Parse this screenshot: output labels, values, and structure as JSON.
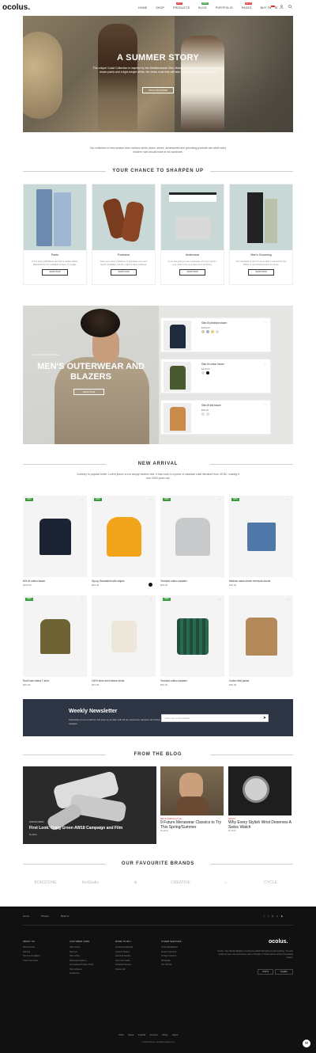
{
  "header": {
    "logo": "ocolus.",
    "nav": [
      {
        "label": "HOME",
        "badge": ""
      },
      {
        "label": "SHOP",
        "badge": ""
      },
      {
        "label": "PRODUCTS",
        "badge": "HOT",
        "badge_color": "#d33"
      },
      {
        "label": "BLOG",
        "badge": "NEW",
        "badge_color": "#3a9b3a"
      },
      {
        "label": "PORTFOLIO",
        "badge": ""
      },
      {
        "label": "PAGES",
        "badge": "SALE",
        "badge_color": "#d33"
      },
      {
        "label": "BUY THEME",
        "badge": ""
      }
    ]
  },
  "hero": {
    "title": "A SUMMER STORY",
    "text": "The unique Coast Collection is inspired by the Mediterranean Sea. Makes it ideal for a four-season look, of brown pants and a light-weight shirts, the dress code that will take you down wherever you want",
    "button": "DISCOVER MORE"
  },
  "intro": "Our collection of new season tees, buttons shirts, jeans, shoes, accessories and grooming products are what every modern man should have in his wardrobe.",
  "section_sharpen": "YOUR CHANCE TO SHARPEN UP",
  "categories": [
    {
      "name": "Pants",
      "desc": "It is a long established fact that a reader will be distracted by the readable content of a page.",
      "button": "SHOP NOW"
    },
    {
      "name": "Footwear",
      "desc": "There are many variations of passages of Lorem Ipsum available, but the majority have suffered.",
      "button": "SHOP NOW"
    },
    {
      "name": "Underwear",
      "desc": "If you are going to use a passage of Lorem Ipsum, you need to be sure there isn't anything.",
      "button": "SHOP NOW"
    },
    {
      "name": "Men's Grooming",
      "desc": "The standard chunk of Lorem Ipsum used since the 1500s is reproduced below for those.",
      "button": "SHOP NOW"
    }
  ],
  "men": {
    "small": "COLLECTION 2020 SALE",
    "title": "MEN'S OUTERWEAR AND BLAZERS",
    "button": "SHOP NOW",
    "products": [
      {
        "name": "Slim-fit pinstripe blazer",
        "price": "$159.00",
        "color": "#1e2a3d"
      },
      {
        "name": "Slim-fit cotton blazer",
        "price": "$129.00",
        "color": "#4a5a30"
      },
      {
        "name": "Slim-fit silk blazer",
        "price": "$99.00",
        "color": "#c98a4a"
      }
    ]
  },
  "section_arrival": "NEW ARRIVAL",
  "arrival_text": "Contrary to popular belief, Lorem Ipsum is not simply random text. It has roots in a piece of classical Latin literature from 45 BC, making it over 2000 years old.",
  "products": [
    {
      "name": "80's fit cotton blazer",
      "price": "$129.00",
      "badge": "NEW"
    },
    {
      "name": "Zip-up Sweatshirt with stripes",
      "price": "$69.00",
      "badge": "NEW"
    },
    {
      "name": "Textured cotton sweater",
      "price": "$59.00",
      "badge": "NEW"
    },
    {
      "name": "Medium wash denim bermuda shorts",
      "price": "$49.00",
      "badge": "NEW"
    },
    {
      "name": "Rust linen-blend T-shirt",
      "price": "$39.00",
      "badge": "NEW"
    },
    {
      "name": "100% linen shirt sleeve shirts",
      "price": "$49.00",
      "badge": ""
    },
    {
      "name": "Textured cotton sweater",
      "price": "$59.00",
      "badge": "NEW"
    },
    {
      "name": "Cotton field jacket",
      "price": "$99.00",
      "badge": ""
    }
  ],
  "newsletter": {
    "title": "Weekly Newsletter",
    "text": "Subscribe to our email list and stay up-to-date with all our awesome releases and latest updates.",
    "placeholder": "Enter your email address"
  },
  "section_blog": "FROM THE BLOG",
  "blog": [
    {
      "tag": "FASHION NEWS",
      "title": "First Look: Craig Green AW18 Campaign and Film",
      "by": "By admin"
    },
    {
      "tag": "MEN'S FASHION STYLE",
      "title": "9 Future Menswear Classics to Try This Spring/Summer",
      "by": "By admin"
    },
    {
      "tag": "WATCH",
      "title": "Why Every Stylish Wrist Deserves A Swiss Watch",
      "by": "By admin"
    }
  ],
  "section_brands": "OUR FAVOURITE BRANDS",
  "brands": [
    "BONSTONE",
    "thoStudio",
    "⊕",
    "CREATIVE",
    "⌂",
    "CYCLE"
  ],
  "footer": {
    "top_links": [
      "Home",
      "Privacy",
      "Returns"
    ],
    "columns": [
      {
        "title": "ABOUT US",
        "links": [
          "About Ocolus",
          "Sitemap",
          "Terms & Conditions",
          "Track Your Order"
        ]
      },
      {
        "title": "CUSTOMER CARE",
        "links": [
          "Help Center",
          "Payment",
          "How to Buy",
          "Shipping & Delivery",
          "International Product Policy",
          "How to Return",
          "Contact Us"
        ]
      },
      {
        "title": "MORE TO BUY",
        "links": [
          "Gaming Peripherals",
          "Camera Options",
          "Sound Protection",
          "Xbox One Guide",
          "Computer Devices",
          "Ocolus Gift"
        ]
      },
      {
        "title": "OTHER SERVICES",
        "links": [
          "Ocolus Broadband",
          "Ocolus Insurance",
          "Foreign Currency",
          "Wholesale",
          "The Gift Set"
        ]
      }
    ],
    "logo": "ocolus.",
    "desc": "Ocolus - the ultimate Shopify e-commerce toolkit that helps you sell anything. The best choice for your next ecommerce store is Shopify or Ocolus and be online immediately project.",
    "currency": "USD $",
    "language": "English",
    "payments": [
      "VISA",
      "Stripe",
      "PayPal",
      "Amazon",
      "GPay",
      "Apple"
    ],
    "copyright": "© 2020 Ocolus. All Rights Reserved."
  }
}
